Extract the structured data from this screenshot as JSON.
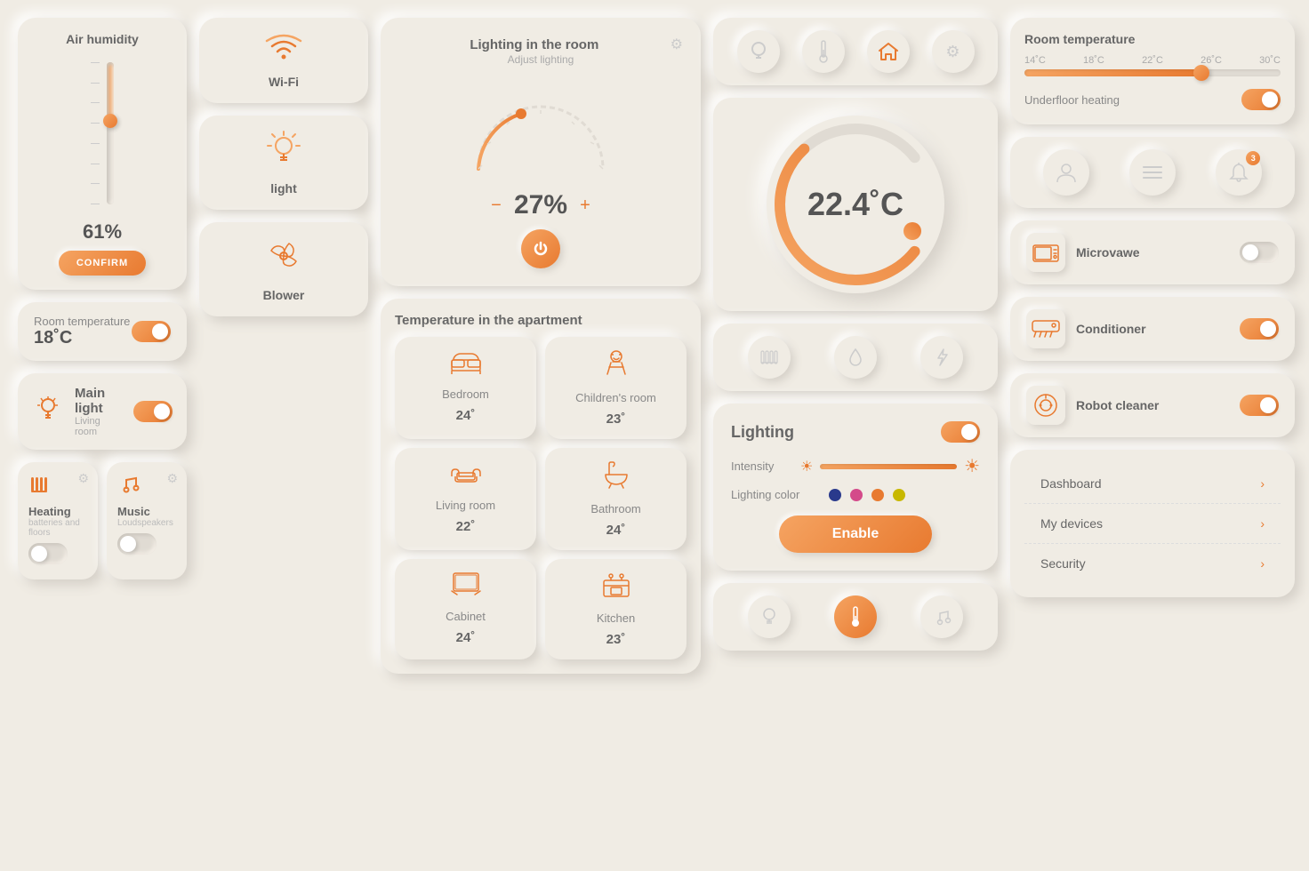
{
  "humidity": {
    "title": "Air humidity",
    "value": "61%",
    "confirm_label": "CONFIRM"
  },
  "wifi": {
    "label": "Wi-Fi"
  },
  "light_device": {
    "label": "light"
  },
  "blower": {
    "label": "Blower"
  },
  "room_temperature_left": {
    "label": "Room temperature",
    "value": "18˚C"
  },
  "main_light": {
    "label": "Main light",
    "sublabel": "Living room"
  },
  "heating": {
    "label": "Heating",
    "sublabel": "batteries and floors"
  },
  "music": {
    "label": "Music",
    "sublabel": "Loudspeakers"
  },
  "lighting_room": {
    "title": "Lighting in the room",
    "subtitle": "Adjust lighting",
    "value": "27%"
  },
  "temperature_apt": {
    "title": "Temperature in the apartment",
    "rooms": [
      {
        "name": "Bedroom",
        "temp": "24˚",
        "icon": "🛏"
      },
      {
        "name": "Children's room",
        "temp": "23˚",
        "icon": "🧸"
      },
      {
        "name": "Living room",
        "temp": "22˚",
        "icon": "🛋"
      },
      {
        "name": "Bathroom",
        "temp": "24˚",
        "icon": "🚿"
      },
      {
        "name": "Cabinet",
        "temp": "24˚",
        "icon": "📺"
      },
      {
        "name": "Kitchen",
        "temp": "23˚",
        "icon": "🍳"
      }
    ]
  },
  "thermostat": {
    "value": "22.4˚C"
  },
  "lighting_panel": {
    "title": "Lighting",
    "intensity_label": "Intensity",
    "color_label": "Lighting color",
    "enable_label": "Enable",
    "colors": [
      "#2a3a8c",
      "#d44a8a",
      "#e87a30",
      "#c8b800"
    ]
  },
  "room_temperature_right": {
    "title": "Room temperature",
    "scale": [
      "14˚C",
      "18˚C",
      "22˚C",
      "26˚C",
      "30˚C"
    ],
    "underfloor_label": "Underfloor heating"
  },
  "appliances": [
    {
      "name": "Microvawe",
      "icon": "📟",
      "active": false
    },
    {
      "name": "Conditioner",
      "icon": "❄",
      "active": true
    },
    {
      "name": "Robot cleaner",
      "icon": "🤖",
      "active": true
    }
  ],
  "menu": {
    "items": [
      {
        "label": "Dashboard"
      },
      {
        "label": "My devices"
      },
      {
        "label": "Security"
      }
    ]
  },
  "notification_badge": "3"
}
